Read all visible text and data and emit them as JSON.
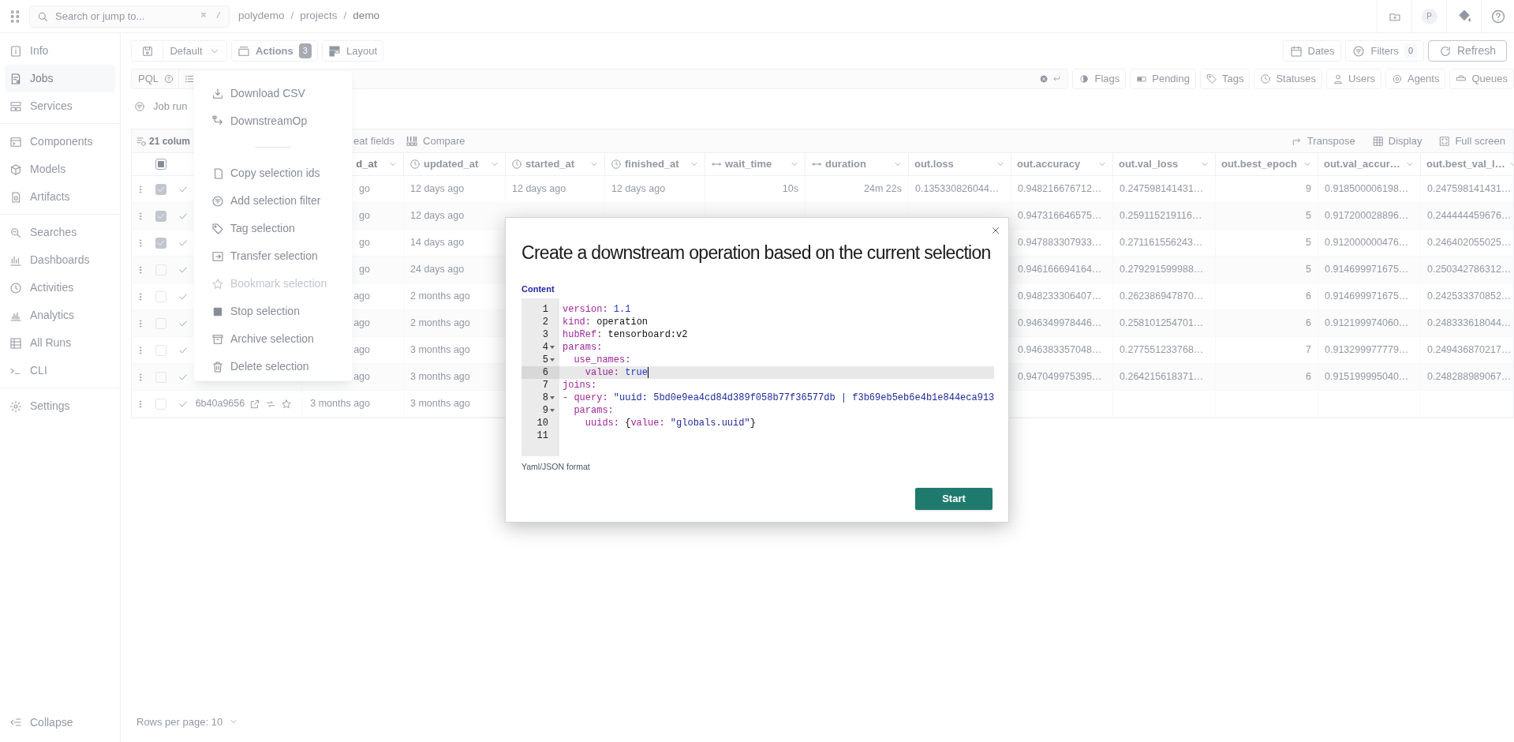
{
  "topbar": {
    "search": {
      "placeholder": "Search or jump to..."
    },
    "shortcut": [
      "⌘",
      "/"
    ],
    "breadcrumb": [
      {
        "kind": "link",
        "text": "polydemo"
      },
      {
        "kind": "separator",
        "text": "/"
      },
      {
        "kind": "link",
        "text": "projects"
      },
      {
        "kind": "separator",
        "text": "/"
      },
      {
        "kind": "current",
        "text": "demo"
      }
    ],
    "avatar": "P"
  },
  "sidebar": {
    "groups": [
      [
        {
          "label": "Info",
          "selected": false
        },
        {
          "label": "Jobs",
          "selected": true
        },
        {
          "label": "Services",
          "selected": false
        }
      ],
      [
        {
          "label": "Components",
          "selected": false
        },
        {
          "label": "Models",
          "selected": false
        },
        {
          "label": "Artifacts",
          "selected": false
        }
      ],
      [
        {
          "label": "Searches",
          "selected": false
        },
        {
          "label": "Dashboards",
          "selected": false
        },
        {
          "label": "Activities",
          "selected": false
        },
        {
          "label": "Analytics",
          "selected": false
        },
        {
          "label": "All Runs",
          "selected": false
        },
        {
          "label": "CLI",
          "selected": false
        }
      ],
      [
        {
          "label": "Settings",
          "selected": false
        }
      ]
    ],
    "collapse": "Collapse"
  },
  "toolbar": {
    "preset": "Default",
    "actions": {
      "label": "Actions",
      "count": "3"
    },
    "layout": "Layout",
    "right": [
      {
        "kind": "plain",
        "label": "Dates"
      },
      {
        "kind": "count",
        "label": "Filters",
        "count": "0"
      },
      {
        "kind": "outlined",
        "label": "Refresh"
      }
    ]
  },
  "query_bar": {
    "mode": "PQL",
    "filters": [
      "Flags",
      "Pending",
      "Tags",
      "Statuses",
      "Users",
      "Agents",
      "Queues"
    ]
  },
  "filter_hint": "Job run",
  "table_toolbar": {
    "columns_button": "21 colum",
    "heat_button": "eat fields",
    "compare_button": "Compare",
    "right": [
      "Transpose",
      "Display",
      "Full screen"
    ]
  },
  "table": {
    "header_checkbox": {
      "indeterminate": true
    },
    "columns": [
      {
        "label": "d_at",
        "kind": "time"
      },
      {
        "label": "updated_at",
        "kind": "time"
      },
      {
        "label": "started_at",
        "kind": "time"
      },
      {
        "label": "finished_at",
        "kind": "time"
      },
      {
        "label": "wait_time",
        "kind": "span"
      },
      {
        "label": "duration",
        "kind": "span"
      },
      {
        "label": "out.loss",
        "kind": "float"
      },
      {
        "label": "out.accuracy",
        "kind": "float"
      },
      {
        "label": "out.val_loss",
        "kind": "float"
      },
      {
        "label": "out.best_epoch",
        "kind": "int"
      },
      {
        "label": "out.val_accur…",
        "kind": "float"
      },
      {
        "label": "out.best_val_l…",
        "kind": "float"
      }
    ],
    "rows": [
      {
        "checked": true,
        "cells": [
          "go",
          "12 days ago",
          "12 days ago",
          "12 days ago",
          "10s",
          "24m 22s",
          "0.135330826044…",
          "0.948216676712…",
          "0.247598141431…",
          "9",
          "0.918500006198…",
          "0.247598141431…"
        ]
      },
      {
        "checked": true,
        "cells": [
          "go",
          "12 days ago",
          null,
          null,
          null,
          null,
          null,
          "0.947316646575…",
          "0.259115219116…",
          "5",
          "0.917200028896…",
          "0.244444459676…"
        ]
      },
      {
        "checked": true,
        "cells": [
          "go",
          "14 days ago",
          null,
          null,
          null,
          null,
          null,
          "0.947883307933…",
          "0.271161556243…",
          "5",
          "0.912000000476…",
          "0.246402055025…"
        ]
      },
      {
        "checked": false,
        "cells": [
          "go",
          "24 days ago",
          null,
          null,
          null,
          null,
          null,
          "0.946166694164…",
          "0.279291599988…",
          "5",
          "0.914699971675…",
          "0.250342786312…"
        ]
      },
      {
        "checked": false,
        "cells": [
          "ago",
          "2 months ago",
          null,
          null,
          null,
          null,
          null,
          "0.948233306407…",
          "0.262386947870…",
          "6",
          "0.914699971675…",
          "0.242533370852…"
        ]
      },
      {
        "checked": false,
        "cells": [
          "ago",
          "2 months ago",
          null,
          null,
          null,
          null,
          null,
          "0.946349978446…",
          "0.258101254701…",
          "6",
          "0.912199974060…",
          "0.248333618044…"
        ]
      },
      {
        "checked": false,
        "cells": [
          "ago",
          "3 months ago",
          null,
          null,
          null,
          null,
          null,
          "0.946383357048…",
          "0.277551233768…",
          "7",
          "0.913299977779…",
          "0.249436870217…"
        ]
      },
      {
        "checked": false,
        "cells": [
          "ago",
          "3 months ago",
          null,
          null,
          null,
          null,
          null,
          "0.947049975395…",
          "0.264215618371…",
          "6",
          "0.915199995040…",
          "0.248288989067…"
        ]
      },
      {
        "checked": false,
        "uuid": "6b40a9656",
        "cells": [
          "3 months ago",
          "3 months ago",
          null,
          null,
          null,
          null,
          null,
          null,
          null,
          null,
          null,
          null
        ]
      }
    ],
    "footer": "Rows per page: 10"
  },
  "actions_menu": {
    "groups": [
      [
        {
          "label": "Download CSV",
          "disabled": false
        },
        {
          "label": "DownstreamOp",
          "disabled": false
        }
      ],
      [
        {
          "label": "Copy selection ids",
          "disabled": false
        },
        {
          "label": "Add selection filter",
          "disabled": false
        },
        {
          "label": "Tag selection",
          "disabled": false
        },
        {
          "label": "Transfer selection",
          "disabled": false
        },
        {
          "label": "Bookmark selection",
          "disabled": true
        },
        {
          "label": "Stop selection",
          "disabled": false
        },
        {
          "label": "Archive selection",
          "disabled": false
        },
        {
          "label": "Delete selection",
          "disabled": false
        }
      ]
    ]
  },
  "dialog": {
    "title": "Create a downstream operation based on the current selection",
    "field_label": "Content",
    "editor": {
      "lines": [
        {
          "number": "1",
          "foldable": false,
          "active": false,
          "tokens": [
            {
              "kind": "key",
              "text": "version:"
            },
            {
              "kind": "number",
              "text": " 1.1"
            }
          ]
        },
        {
          "number": "2",
          "foldable": false,
          "active": false,
          "tokens": [
            {
              "kind": "key",
              "text": "kind:"
            },
            {
              "kind": "plain",
              "text": " operation"
            }
          ]
        },
        {
          "number": "3",
          "foldable": false,
          "active": false,
          "tokens": [
            {
              "kind": "key",
              "text": "hubRef:"
            },
            {
              "kind": "plain",
              "text": " tensorboard:v2"
            }
          ]
        },
        {
          "number": "4",
          "foldable": true,
          "active": false,
          "tokens": [
            {
              "kind": "key",
              "text": "params:"
            }
          ]
        },
        {
          "number": "5",
          "foldable": true,
          "active": false,
          "tokens": [
            {
              "kind": "key",
              "text": "  use_names:"
            }
          ]
        },
        {
          "number": "6",
          "foldable": false,
          "active": true,
          "tokens": [
            {
              "kind": "key",
              "text": "    value:"
            },
            {
              "kind": "number",
              "text": " true"
            }
          ]
        },
        {
          "number": "7",
          "foldable": false,
          "active": false,
          "tokens": [
            {
              "kind": "key",
              "text": "joins:"
            }
          ]
        },
        {
          "number": "8",
          "foldable": true,
          "active": false,
          "tokens": [
            {
              "kind": "key",
              "text": "- query:"
            },
            {
              "kind": "string",
              "text": " \"uuid: 5bd0e9ea4cd84d389f058b77f36577db | f3b69eb5eb6e4b1e844eca913"
            }
          ]
        },
        {
          "number": "9",
          "foldable": true,
          "active": false,
          "tokens": [
            {
              "kind": "key",
              "text": "  params:"
            }
          ]
        },
        {
          "number": "10",
          "foldable": false,
          "active": false,
          "tokens": [
            {
              "kind": "key",
              "text": "    uuids:"
            },
            {
              "kind": "plain",
              "text": " {"
            },
            {
              "kind": "key",
              "text": "value:"
            },
            {
              "kind": "string",
              "text": " \"globals.uuid\""
            },
            {
              "kind": "plain",
              "text": "}"
            }
          ]
        },
        {
          "number": "11",
          "foldable": false,
          "active": false
        }
      ]
    },
    "help": "Yaml/JSON format",
    "submit": "Start"
  }
}
